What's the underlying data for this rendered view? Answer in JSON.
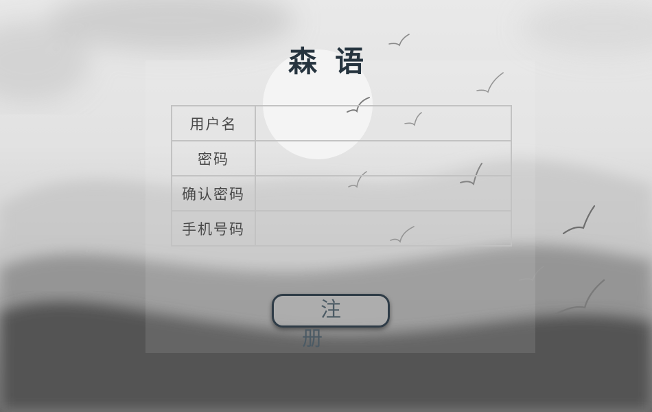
{
  "app": {
    "title": "森语"
  },
  "form": {
    "fields": [
      {
        "label": "用户名",
        "value": "",
        "placeholder": ""
      },
      {
        "label": "密码",
        "value": "",
        "placeholder": ""
      },
      {
        "label": "确认密码",
        "value": "",
        "placeholder": ""
      },
      {
        "label": "手机号码",
        "value": "",
        "placeholder": ""
      }
    ],
    "submit_label": "注册"
  },
  "colors": {
    "title": "#26343f",
    "button_border": "#2f3c47",
    "table_border": "#c2c2c2"
  },
  "decor": {
    "moon": "moon-icon",
    "birds": "bird-icon",
    "mountains": "ink-mountains"
  }
}
